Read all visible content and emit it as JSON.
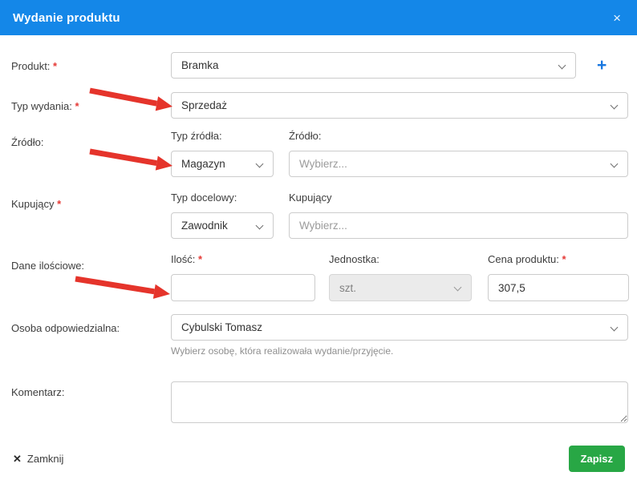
{
  "modal": {
    "title": "Wydanie produktu",
    "close_icon": "×"
  },
  "form": {
    "produkt": {
      "label": "Produkt: ",
      "required_mark": "*",
      "value": "Bramka",
      "add_icon": "+"
    },
    "typ_wydania": {
      "label": "Typ wydania: ",
      "required_mark": "*",
      "value": "Sprzedaż"
    },
    "zrodlo": {
      "label": "Źródło:",
      "typ_zrodla_label": "Typ źródła:",
      "typ_zrodla_value": "Magazyn",
      "zrodlo_label": "Źródło:",
      "zrodlo_placeholder": "Wybierz..."
    },
    "kupujacy": {
      "label": "Kupujący ",
      "required_mark": "*",
      "typ_docelowy_label": "Typ docelowy:",
      "typ_docelowy_value": "Zawodnik",
      "kupujacy_label": "Kupujący",
      "kupujacy_placeholder": "Wybierz..."
    },
    "dane_ilosciowe": {
      "label": "Dane ilościowe:",
      "ilosc_label": "Ilość: ",
      "ilosc_required_mark": "*",
      "ilosc_value": "",
      "jednostka_label": "Jednostka:",
      "jednostka_value": "szt.",
      "cena_label": "Cena produktu: ",
      "cena_required_mark": "*",
      "cena_value": "307,5"
    },
    "osoba": {
      "label": "Osoba odpowiedzialna:",
      "value": "Cybulski Tomasz",
      "helper": "Wybierz osobę, która realizowała wydanie/przyjęcie."
    },
    "komentarz": {
      "label": "Komentarz:",
      "value": ""
    }
  },
  "footer": {
    "close_icon": "✕",
    "close_label": "Zamknij",
    "save_label": "Zapisz"
  },
  "annotations": {
    "arrow_color": "#e5342b",
    "arrows": [
      "arrow-to-typ-wydania",
      "arrow-to-typ-zrodla",
      "arrow-to-ilosc"
    ]
  },
  "colors": {
    "header_bg": "#1487e8",
    "save_green": "#28a745",
    "accent_blue": "#1877e0",
    "required_red": "#e53935"
  }
}
